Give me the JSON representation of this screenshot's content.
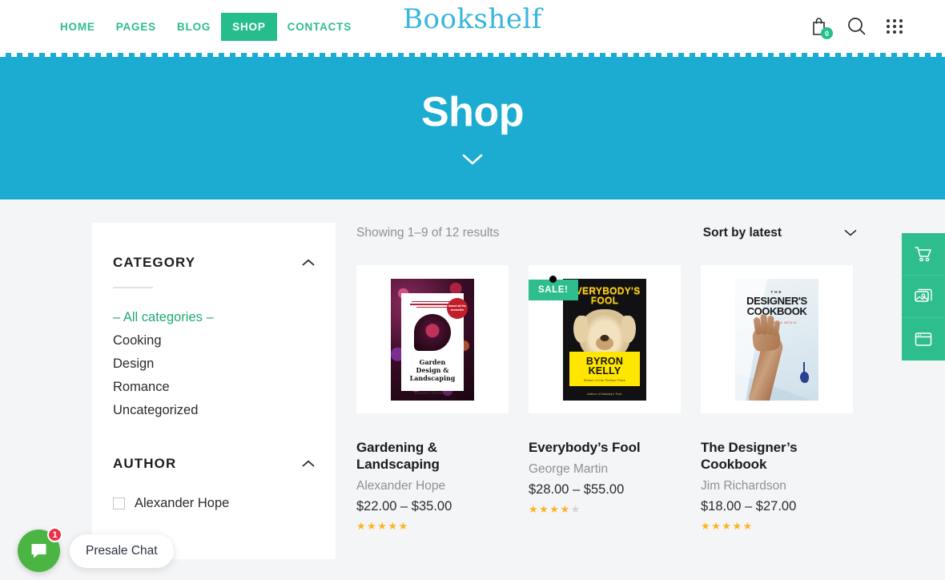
{
  "header": {
    "nav": [
      {
        "label": "HOME",
        "active": false
      },
      {
        "label": "PAGES",
        "active": false
      },
      {
        "label": "BLOG",
        "active": false
      },
      {
        "label": "SHOP",
        "active": true
      },
      {
        "label": "CONTACTS",
        "active": false
      }
    ],
    "logo": "Bookshelf",
    "cart_count": "0",
    "icons": [
      "shopping-bag-icon",
      "search-icon",
      "grid-menu-icon"
    ]
  },
  "hero": {
    "title": "Shop",
    "scroll_icon": "chevron-down-icon",
    "background_color": "#1cacd2"
  },
  "sidebar": {
    "category": {
      "title": "CATEGORY",
      "collapse_icon": "chevron-up-icon",
      "items": [
        {
          "label": "– All categories –",
          "active": true
        },
        {
          "label": "Cooking",
          "active": false
        },
        {
          "label": "Design",
          "active": false
        },
        {
          "label": "Romance",
          "active": false
        },
        {
          "label": "Uncategorized",
          "active": false
        }
      ]
    },
    "author": {
      "title": "AUTHOR",
      "collapse_icon": "chevron-up-icon",
      "items": [
        {
          "label": "Alexander Hope",
          "checked": false
        }
      ]
    }
  },
  "toolbar": {
    "results": "Showing 1–9 of 12 results",
    "sort_label": "Sort by latest",
    "sort_icon": "chevron-down-icon"
  },
  "products": [
    {
      "title": "Gardening & Landscaping",
      "author": "Alexander Hope",
      "price": "$22.00 – $35.00",
      "rating": 5,
      "sale": false,
      "cover": {
        "headline": "Garden Design & Landscaping",
        "byline": "Russell Reynolds",
        "seal": "based all the bestseller"
      }
    },
    {
      "title": "Everybody’s Fool",
      "author": "George Martin",
      "price": "$28.00 – $55.00",
      "rating": 4,
      "sale": true,
      "sale_label": "SALE!",
      "cover": {
        "title_line1": "EVERYBODY'S",
        "title_line2": "FOOL",
        "author_line1": "BYRON",
        "author_line2": "KELLY",
        "subtitle": "Winner of the Pulitzer Prize",
        "footer": "Author of Nobody's Fool"
      }
    },
    {
      "title": "The Designer’s Cookbook",
      "author": "Jim Richardson",
      "price": "$18.00 – $27.00",
      "rating": 5,
      "sale": false,
      "cover": {
        "eyebrow": "THE",
        "title_line1": "DESIGNER'S",
        "title_line2": "COOKBOOK",
        "subtitle": "IN COLORS & MEDIA"
      }
    }
  ],
  "right_panel": [
    {
      "icon": "shopping-cart-icon"
    },
    {
      "icon": "images-gallery-icon"
    },
    {
      "icon": "browser-window-icon"
    }
  ],
  "chat": {
    "label": "Presale Chat",
    "badge": "1",
    "icon": "chat-bubble-icon"
  },
  "stars": {
    "filled": "★",
    "empty": "★"
  },
  "colors": {
    "accent_green": "#2ebd8d",
    "hero_blue": "#1cacd2",
    "logo_blue": "#38b5dd",
    "page_bg": "#f4f5f6",
    "star_gold": "#ffb322",
    "chat_green": "#4bb543",
    "badge_red": "#e8334a"
  }
}
